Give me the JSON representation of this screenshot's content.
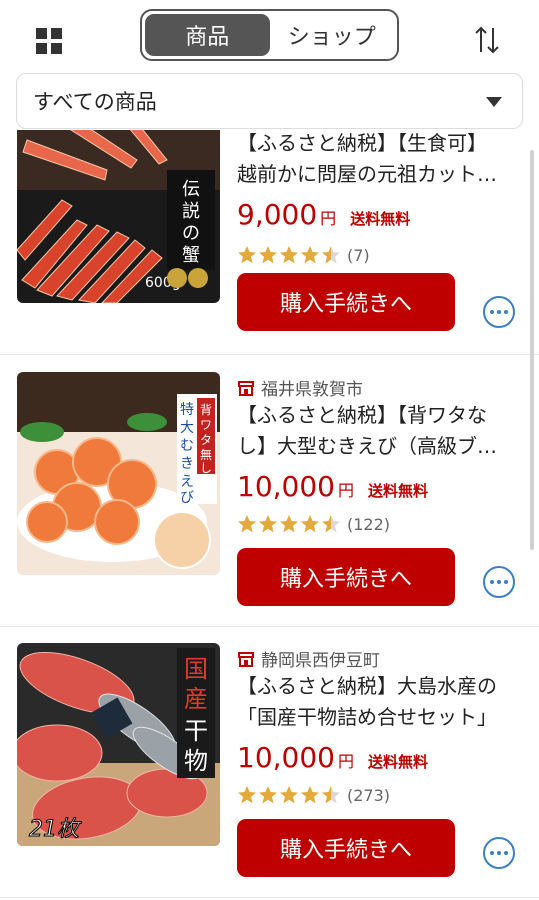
{
  "header": {
    "tabs": [
      {
        "label": "商品",
        "active": true
      },
      {
        "label": "ショップ",
        "active": false
      }
    ],
    "grid_icon": "grid-icon",
    "sort_icon": "sort-icon"
  },
  "filter": {
    "selected": "すべての商品"
  },
  "accent_color": "#bf0000",
  "items": [
    {
      "location": "",
      "title_line1": "【ふるさと納税】【生食可】",
      "title_line2": "越前かに問屋の元祖カット…",
      "price": "9,000",
      "yen": "円",
      "shipping": "送料無料",
      "rating": 4.5,
      "review_count": "(7)",
      "button": "購入手続きへ",
      "image_text": {
        "vertical": "伝説の蟹",
        "weight": "600g"
      }
    },
    {
      "location": "福井県敦賀市",
      "title_line1": "【ふるさと納税】【背ワタな",
      "title_line2": "し】大型むきえび（高級ブ…",
      "price": "10,000",
      "yen": "円",
      "shipping": "送料無料",
      "rating": 4.5,
      "review_count": "(122)",
      "button": "購入手続きへ",
      "image_text": {
        "badge": "背ワタ無し",
        "vertical": "特大むきえび"
      }
    },
    {
      "location": "静岡県西伊豆町",
      "title_line1": "【ふるさと納税】大島水産の",
      "title_line2": "「国産干物詰め合せセット」",
      "price": "10,000",
      "yen": "円",
      "shipping": "送料無料",
      "rating": 4.5,
      "review_count": "(273)",
      "button": "購入手続きへ",
      "image_text": {
        "vertical": "国産干物",
        "count": "21枚"
      }
    }
  ]
}
